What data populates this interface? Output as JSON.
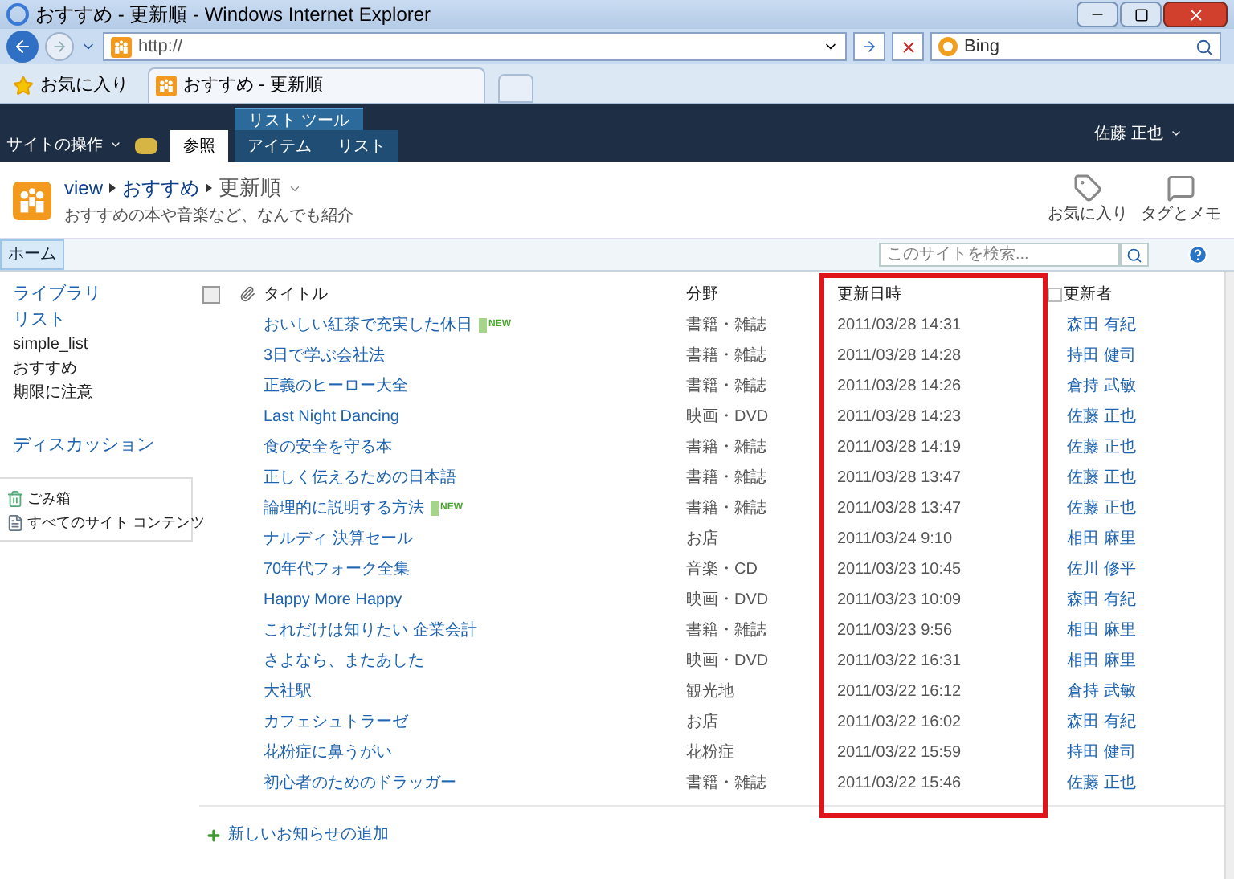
{
  "window": {
    "title": "おすすめ - 更新順 - Windows Internet Explorer"
  },
  "address_bar": {
    "url": "http://",
    "search_engine": "Bing"
  },
  "favorites_bar": {
    "favorites": "お気に入り",
    "tab": "おすすめ - 更新順"
  },
  "ribbon": {
    "site_actions": "サイトの操作",
    "tool_group": "リスト ツール",
    "tabs": [
      {
        "label": "参照",
        "selected": true
      },
      {
        "label": "アイテム",
        "selected": false
      },
      {
        "label": "リスト",
        "selected": false
      }
    ],
    "user": "佐藤 正也"
  },
  "page_header": {
    "breadcrumb": [
      "view",
      "おすすめ",
      "更新順"
    ],
    "description": "おすすめの本や音楽など、なんでも紹介",
    "actions": [
      {
        "label": "お気に入り",
        "kind": "like"
      },
      {
        "label": "タグとメモ",
        "kind": "tag"
      }
    ]
  },
  "top_nav": {
    "home": "ホーム",
    "search_placeholder": "このサイトを検索..."
  },
  "sidebar": {
    "items": [
      {
        "label": "ライブラリ",
        "kind": "heading"
      },
      {
        "label": "リスト",
        "kind": "heading"
      },
      {
        "label": "simple_list",
        "kind": "item"
      },
      {
        "label": "おすすめ",
        "kind": "item"
      },
      {
        "label": "期限に注意",
        "kind": "item"
      },
      {
        "label": "ディスカッション",
        "kind": "heading"
      }
    ],
    "bottom": [
      {
        "label": "ごみ箱",
        "kind": "trash"
      },
      {
        "label": "すべてのサイト コンテンツ",
        "kind": "content"
      }
    ]
  },
  "table": {
    "select_all": {
      "checked": false
    },
    "columns": [
      {
        "label": "タイトル",
        "highlighted": false
      },
      {
        "label": "分野",
        "highlighted": false
      },
      {
        "label": "更新日時",
        "highlighted": true
      },
      {
        "label": "更新者",
        "highlighted": false
      }
    ],
    "rows": [
      {
        "title": "おいしい紅茶で充実した休日",
        "badge": "NEW",
        "category": "書籍・雑誌",
        "modified": "2011/03/28 14:31",
        "modified_by": "森田 有紀"
      },
      {
        "title": "3日で学ぶ会社法",
        "category": "書籍・雑誌",
        "modified": "2011/03/28 14:28",
        "modified_by": "持田 健司"
      },
      {
        "title": "正義のヒーロー大全",
        "category": "書籍・雑誌",
        "modified": "2011/03/28 14:26",
        "modified_by": "倉持 武敏"
      },
      {
        "title": "Last Night Dancing",
        "category": "映画・DVD",
        "modified": "2011/03/28 14:23",
        "modified_by": "佐藤 正也"
      },
      {
        "title": "食の安全を守る本",
        "category": "書籍・雑誌",
        "modified": "2011/03/28 14:19",
        "modified_by": "佐藤 正也"
      },
      {
        "title": "正しく伝えるための日本語",
        "category": "書籍・雑誌",
        "modified": "2011/03/28 13:47",
        "modified_by": "佐藤 正也"
      },
      {
        "title": "論理的に説明する方法",
        "badge": "NEW",
        "category": "書籍・雑誌",
        "modified": "2011/03/28 13:47",
        "modified_by": "佐藤 正也"
      },
      {
        "title": "ナルディ 決算セール",
        "category": "お店",
        "modified": "2011/03/24 9:10",
        "modified_by": "相田 麻里"
      },
      {
        "title": "70年代フォーク全集",
        "category": "音楽・CD",
        "modified": "2011/03/23 10:45",
        "modified_by": "佐川 修平"
      },
      {
        "title": "Happy More Happy",
        "category": "映画・DVD",
        "modified": "2011/03/23 10:09",
        "modified_by": "森田 有紀"
      },
      {
        "title": "これだけは知りたい 企業会計",
        "category": "書籍・雑誌",
        "modified": "2011/03/23 9:56",
        "modified_by": "相田 麻里"
      },
      {
        "title": "さよなら、またあした",
        "category": "映画・DVD",
        "modified": "2011/03/22 16:31",
        "modified_by": "相田 麻里"
      },
      {
        "title": "大社駅",
        "category": "観光地",
        "modified": "2011/03/22 16:12",
        "modified_by": "倉持 武敏"
      },
      {
        "title": "カフェシュトラーゼ",
        "category": "お店",
        "modified": "2011/03/22 16:02",
        "modified_by": "森田 有紀"
      },
      {
        "title": "花粉症に鼻うがい",
        "category": "花粉症",
        "modified": "2011/03/22 15:59",
        "modified_by": "持田 健司"
      },
      {
        "title": "初心者のためのドラッガー",
        "category": "書籍・雑誌",
        "modified": "2011/03/22 15:46",
        "modified_by": "佐藤 正也"
      }
    ],
    "add_link": "新しいお知らせの追加"
  }
}
